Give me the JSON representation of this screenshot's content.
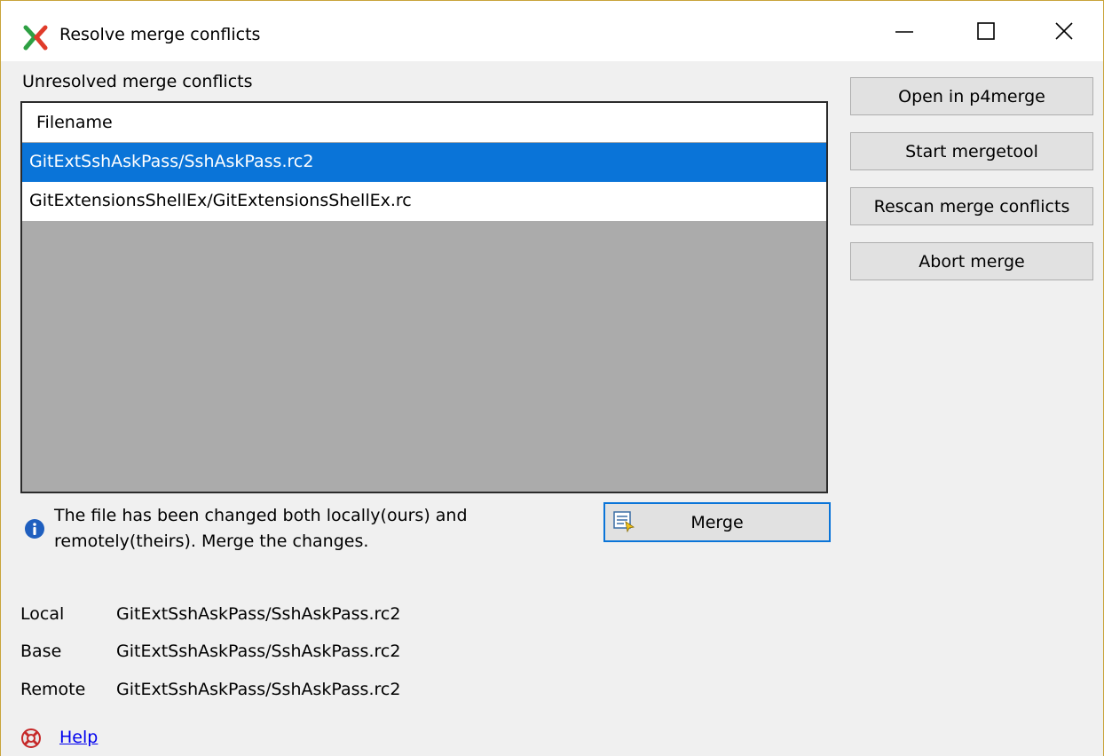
{
  "window": {
    "title": "Resolve merge conflicts"
  },
  "conflicts": {
    "section_label": "Unresolved merge conflicts",
    "column_header": "Filename",
    "rows": [
      {
        "filename": "GitExtSshAskPass/SshAskPass.rc2",
        "selected": true
      },
      {
        "filename": "GitExtensionsShellEx/GitExtensionsShellEx.rc",
        "selected": false
      }
    ]
  },
  "actions": {
    "open_p4merge": "Open in p4merge",
    "start_mergetool": "Start mergetool",
    "rescan": "Rescan merge conflicts",
    "abort": "Abort merge"
  },
  "info": {
    "message": "The file has been changed both locally(ours) and remotely(theirs). Merge the changes.",
    "merge_button": "Merge"
  },
  "details": {
    "local_label": "Local",
    "local_value": "GitExtSshAskPass/SshAskPass.rc2",
    "base_label": "Base",
    "base_value": "GitExtSshAskPass/SshAskPass.rc2",
    "remote_label": "Remote",
    "remote_value": "GitExtSshAskPass/SshAskPass.rc2"
  },
  "help": {
    "label": "Help"
  },
  "colors": {
    "selection": "#0a74d8",
    "list_empty_area": "#ababab",
    "link": "#0000ee"
  }
}
